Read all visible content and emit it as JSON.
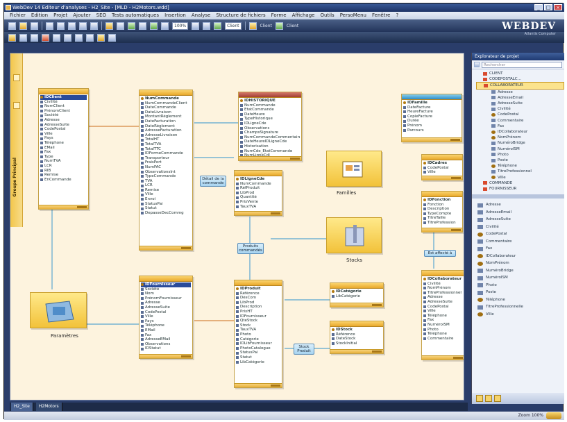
{
  "window": {
    "title": "WebDev 14  Editeur d'analyses - H2_Site - [MLD - H2Motors.wdd]"
  },
  "menu": [
    "Fichier",
    "Edition",
    "Projet",
    "Ajouter",
    "SEO",
    "Tests automatiques",
    "Insertion",
    "Analyse",
    "Structure de fichiers",
    "Forme",
    "Affichage",
    "Outils",
    "PersoMenu",
    "Fenêtre",
    "?"
  ],
  "toolbar": {
    "zoom_value": "100%",
    "field_1": "Client",
    "field_2": "Client",
    "field_3": "Client",
    "logo": "WEBDEV",
    "logo_sub": "Atlantis Computer"
  },
  "left_tab": {
    "label": "Groupe Principal"
  },
  "tables": {
    "client": {
      "fields": [
        "IDClient",
        "Civilité",
        "NomClient",
        "PrénomClient",
        "Société",
        "Adresse",
        "AdresseSuite",
        "CodePostal",
        "Ville",
        "Pays",
        "Téléphone",
        "EMail",
        "Fax",
        "Type",
        "NumTVA",
        "LCR",
        "RIB",
        "Remise",
        "EnCommande"
      ]
    },
    "commande": {
      "fields": [
        "NumCommande",
        "NumCommandeClient",
        "DateCommande",
        "DateLivraison",
        "MontantRéglement",
        "DateFacturation",
        "DateRèglement",
        "AdresseFacturation",
        "AdresseLivraison",
        "TotalHT",
        "TotalTVA",
        "TotalTTC",
        "IDFormeCommande",
        "Transporteur",
        "FraisPort",
        "NumFAC",
        "ObservationsInt",
        "TypeCommande",
        "TVA",
        "LCR",
        "Remise",
        "Ville",
        "Envoi",
        "StatusPai",
        "Statut",
        "DepasseDecCommg"
      ]
    },
    "historique": {
      "fields": [
        "IDHISTORIQUE",
        "NumCommande",
        "EtatCommande",
        "DateHeure",
        "TypeHistorique",
        "IDLigneCde",
        "Observations",
        "ChampsSignature",
        "NumCommandeCommentaire",
        "DateHeureIDLigneCde",
        "Historisation",
        "NumCde_EtatCommande",
        "NumLigneCdl"
      ]
    },
    "lignecde": {
      "fields": [
        "IDLigneCde",
        "NumCommande",
        "RéfProduit",
        "LibProd",
        "Quantité",
        "PrixVente",
        "TauxTVA"
      ]
    },
    "famille": {
      "fields": [
        "IDFamille",
        "DateFacture",
        "HeureFacture",
        "CopieFacture",
        "Durée",
        "Prénom",
        "Parcours"
      ]
    },
    "ccadres": {
      "fields": [
        "IDCadres",
        "CodePostal",
        "Ville"
      ]
    },
    "fonction": {
      "fields": [
        "IDFonction",
        "Fonction",
        "Description",
        "TypeCompte",
        "TitreTaille",
        "TitreProfession"
      ]
    },
    "fournisseur": {
      "fields": [
        "IDFournisseur",
        "Société",
        "Nom",
        "PrénomFournisseur",
        "Adresse",
        "AdresseSuite",
        "CodePostal",
        "Ville",
        "Pays",
        "Téléphone",
        "EMail",
        "Fax",
        "AdresseEMail",
        "Observations",
        "IDStatut"
      ]
    },
    "produit": {
      "fields": [
        "IDProduit",
        "Référence",
        "DésCom",
        "LibProd",
        "Description",
        "PrixHT",
        "IDFournisseur",
        "QtéStock",
        "Stock",
        "TauxTVA",
        "Photo",
        "Catégorie",
        "IDLibFournisseur",
        "PhotoCatalogue",
        "StatusPai",
        "Statut",
        "LibCatégorie"
      ]
    },
    "categorie": {
      "fields": [
        "IDCatégorie",
        "LibCatégorie"
      ]
    },
    "stock": {
      "fields": [
        "IDStock",
        "Référence",
        "DateStock",
        "StockInitial"
      ]
    },
    "collaborateur": {
      "fields": [
        "IDCollaborateur",
        "Civilité",
        "NomPrénom",
        "TitreProfessionnel",
        "Adresse",
        "AdresseSuite",
        "CodePostal",
        "Ville",
        "Téléphone",
        "Fax",
        "NuméroISM",
        "Photo",
        "Téléphone",
        "Commentaire"
      ]
    }
  },
  "link_labels": {
    "detail": "Détail de la commande",
    "produits": "Produits commandés",
    "affecte": "Est affecté à",
    "stock": "Stock Produit"
  },
  "folders": {
    "familles": "Familles",
    "stocks": "Stocks",
    "parametres": "Paramètres"
  },
  "panel": {
    "title": "Explorateur de projet",
    "search_placeholder": "Rechercher",
    "tree": [
      {
        "label": "CLIENT",
        "kind": "tbl2"
      },
      {
        "label": "CODEPOSTALC...",
        "kind": "tbl2"
      },
      {
        "label": "COLLABORATEUR",
        "kind": "tbl2",
        "selected": true
      },
      {
        "label": "Adresse",
        "kind": "f"
      },
      {
        "label": "AdresseEmail",
        "kind": "f"
      },
      {
        "label": "AdresseSuite",
        "kind": "f"
      },
      {
        "label": "Civilité",
        "kind": "f"
      },
      {
        "label": "CodePostal",
        "kind": "key"
      },
      {
        "label": "Commentaire",
        "kind": "f"
      },
      {
        "label": "Fax",
        "kind": "f"
      },
      {
        "label": "IDCollaborateur",
        "kind": "key"
      },
      {
        "label": "NomPrénom",
        "kind": "key"
      },
      {
        "label": "NuméroBridge",
        "kind": "f"
      },
      {
        "label": "NuméroISM",
        "kind": "f"
      },
      {
        "label": "Photo",
        "kind": "f"
      },
      {
        "label": "Poste",
        "kind": "f"
      },
      {
        "label": "Téléphone",
        "kind": "key"
      },
      {
        "label": "TitreProfessionnel",
        "kind": "f"
      },
      {
        "label": "Ville",
        "kind": "key"
      },
      {
        "label": "COMMANDE",
        "kind": "tbl2"
      },
      {
        "label": "FOURNISSEUR",
        "kind": "tbl2"
      }
    ],
    "fields": [
      {
        "label": "Adresse",
        "kind": "f"
      },
      {
        "label": "AdresseEmail",
        "kind": "f"
      },
      {
        "label": "AdresseSuite",
        "kind": "f"
      },
      {
        "label": "Civilité",
        "kind": "f"
      },
      {
        "label": "CodePostal",
        "kind": "key"
      },
      {
        "label": "Commentaire",
        "kind": "f"
      },
      {
        "label": "Fax",
        "kind": "f"
      },
      {
        "label": "IDCollaborateur",
        "kind": "key"
      },
      {
        "label": "NomPrénom",
        "kind": "key"
      },
      {
        "label": "NuméroBridge",
        "kind": "f"
      },
      {
        "label": "NuméroISM",
        "kind": "f"
      },
      {
        "label": "Photo",
        "kind": "f"
      },
      {
        "label": "Poste",
        "kind": "f"
      },
      {
        "label": "Téléphone",
        "kind": "key"
      },
      {
        "label": "TitreProfessionnelle",
        "kind": "f"
      },
      {
        "label": "Ville",
        "kind": "key"
      }
    ]
  },
  "doc_tabs": [
    "H2_Site",
    "H2Motors"
  ],
  "status": {
    "zoom": "Zoom 100%"
  }
}
